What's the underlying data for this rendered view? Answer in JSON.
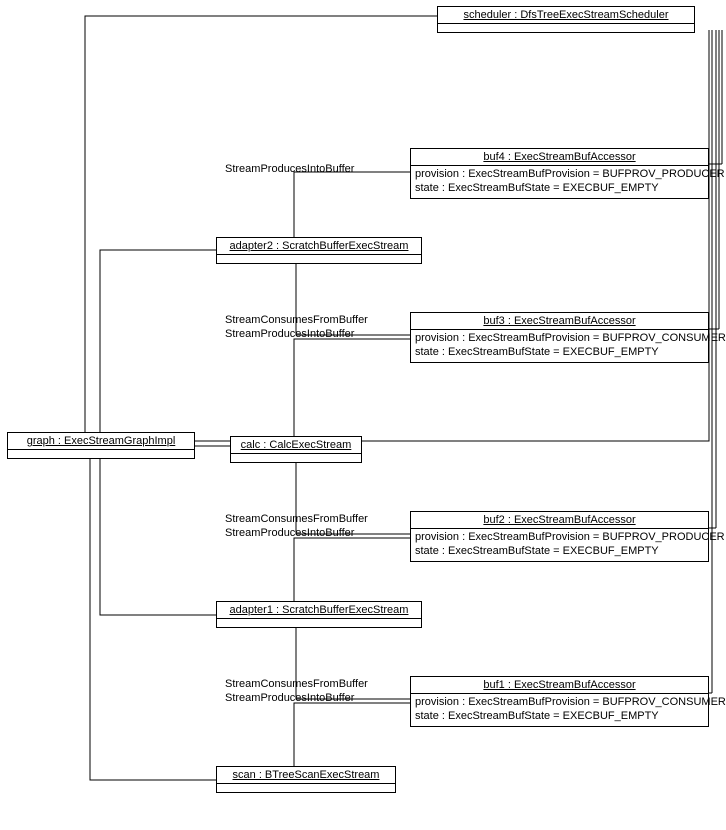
{
  "nodes": {
    "scheduler": {
      "title": "scheduler : DfsTreeExecStreamScheduler"
    },
    "buf4": {
      "title": "buf4 : ExecStreamBufAccessor",
      "provision": "provision : ExecStreamBufProvision = BUFPROV_PRODUCER",
      "state": "state : ExecStreamBufState = EXECBUF_EMPTY"
    },
    "adapter2": {
      "title": "adapter2 : ScratchBufferExecStream"
    },
    "buf3": {
      "title": "buf3 : ExecStreamBufAccessor",
      "provision": "provision : ExecStreamBufProvision = BUFPROV_CONSUMER",
      "state": "state : ExecStreamBufState = EXECBUF_EMPTY"
    },
    "graph": {
      "title": "graph : ExecStreamGraphImpl"
    },
    "calc": {
      "title": "calc : CalcExecStream"
    },
    "buf2": {
      "title": "buf2 : ExecStreamBufAccessor",
      "provision": "provision : ExecStreamBufProvision = BUFPROV_PRODUCER",
      "state": "state : ExecStreamBufState = EXECBUF_EMPTY"
    },
    "adapter1": {
      "title": "adapter1 : ScratchBufferExecStream"
    },
    "buf1": {
      "title": "buf1 : ExecStreamBufAccessor",
      "provision": "provision : ExecStreamBufProvision = BUFPROV_CONSUMER",
      "state": "state : ExecStreamBufState = EXECBUF_EMPTY"
    },
    "scan": {
      "title": "scan : BTreeScanExecStream"
    }
  },
  "labels": {
    "consumes": "StreamConsumesFromBuffer",
    "produces": "StreamProducesIntoBuffer"
  }
}
